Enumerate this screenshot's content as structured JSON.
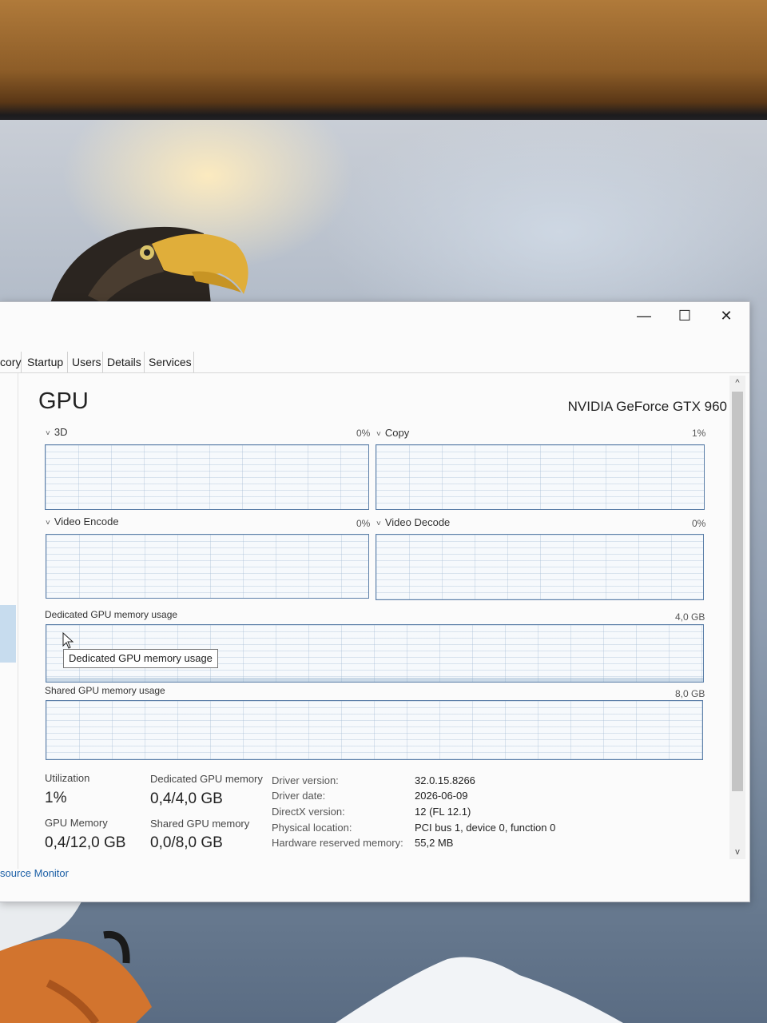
{
  "window": {
    "controls": {
      "minimize": "—",
      "maximize": "☐",
      "close": "✕"
    },
    "tabs": [
      "cory",
      "Startup",
      "Users",
      "Details",
      "Services"
    ]
  },
  "gpu": {
    "heading": "GPU",
    "device_name": "NVIDIA GeForce GTX 960",
    "engines": [
      {
        "label": "3D",
        "percent": "0%",
        "value": 0
      },
      {
        "label": "Copy",
        "percent": "1%",
        "value": 1
      },
      {
        "label": "Video Encode",
        "percent": "0%",
        "value": 0
      },
      {
        "label": "Video Decode",
        "percent": "0%",
        "value": 0
      }
    ],
    "dedicated": {
      "label": "Dedicated GPU memory usage",
      "max": "4,0 GB",
      "used_fraction": 0.1
    },
    "shared": {
      "label": "Shared GPU memory usage",
      "max": "8,0 GB",
      "used_fraction": 0.0
    },
    "tooltip": "Dedicated GPU memory usage"
  },
  "stats": {
    "utilization": {
      "label": "Utilization",
      "value": "1%"
    },
    "dedicated_memory": {
      "label": "Dedicated GPU memory",
      "value": "0,4/4,0 GB"
    },
    "gpu_memory": {
      "label": "GPU Memory",
      "value": "0,4/12,0 GB"
    },
    "shared_memory": {
      "label": "Shared GPU memory",
      "value": "0,0/8,0 GB"
    }
  },
  "properties": [
    {
      "key": "Driver version:",
      "value": "32.0.15.8266"
    },
    {
      "key": "Driver date:",
      "value": "2026-06-09"
    },
    {
      "key": "DirectX version:",
      "value": "12 (FL 12.1)"
    },
    {
      "key": "Physical location:",
      "value": "PCI bus 1, device 0, function 0"
    },
    {
      "key": "Hardware reserved memory:",
      "value": "55,2 MB"
    }
  ],
  "footer": {
    "resource_monitor": "source Monitor"
  },
  "scroll": {
    "up": "^",
    "down": "v"
  },
  "colors": {
    "graph_border": "#5c7fa8",
    "link": "#1b5fa6",
    "selection": "#c7dcee"
  }
}
